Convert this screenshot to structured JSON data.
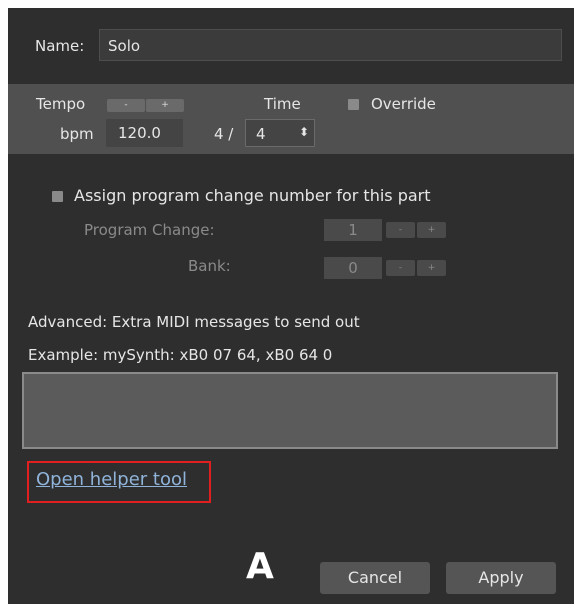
{
  "name": {
    "label": "Name:",
    "value": "Solo"
  },
  "tempo": {
    "tempo_label": "Tempo",
    "minus": "-",
    "plus": "+",
    "bpm_label": "bpm",
    "bpm_value": "120.0",
    "time_label": "Time",
    "time_numerator": "4 /",
    "time_denominator": "4",
    "override_label": "Override"
  },
  "program": {
    "assign_label": "Assign program change number for this part",
    "program_change_label": "Program Change:",
    "program_change_value": "1",
    "bank_label": "Bank:",
    "bank_value": "0",
    "minus": "-",
    "plus": "+"
  },
  "advanced": {
    "title": "Advanced: Extra MIDI messages to send out",
    "example": "Example: mySynth: xB0 07 64, xB0 64 0",
    "textarea_value": ""
  },
  "helper_link": "Open helper tool",
  "annotation": {
    "letter": "A",
    "highlight_color": "#e02020"
  },
  "footer": {
    "cancel": "Cancel",
    "apply": "Apply"
  },
  "colors": {
    "panel": "#2e2e2e",
    "band": "#505050",
    "link": "#8fb3d9",
    "button": "#555555"
  }
}
